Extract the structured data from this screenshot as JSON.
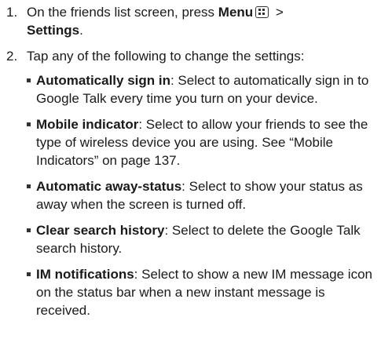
{
  "steps": [
    {
      "number": "1.",
      "text_before": "On the friends list screen, press ",
      "menu_label": "Menu",
      "arrow": " > ",
      "settings_label": "Settings",
      "text_after": "."
    },
    {
      "number": "2.",
      "text": "Tap any of the following to change the settings:"
    }
  ],
  "settings": [
    {
      "label": "Automatically sign in",
      "description": ": Select to automatically sign in to Google Talk every time you turn on your device."
    },
    {
      "label": "Mobile indicator",
      "description": ": Select to allow your friends to see the type of wireless device you are using. See “Mobile Indicators” on page 137."
    },
    {
      "label": "Automatic away-status",
      "description": ": Select to show your status as away when the screen is turned off."
    },
    {
      "label": "Clear search history",
      "description": ": Select to delete the Google Talk search history."
    },
    {
      "label": "IM notifications",
      "description": ": Select to show a new IM message icon on the status bar when a new instant message is received."
    }
  ],
  "icons": {
    "menu_key": "menu-key-icon"
  }
}
